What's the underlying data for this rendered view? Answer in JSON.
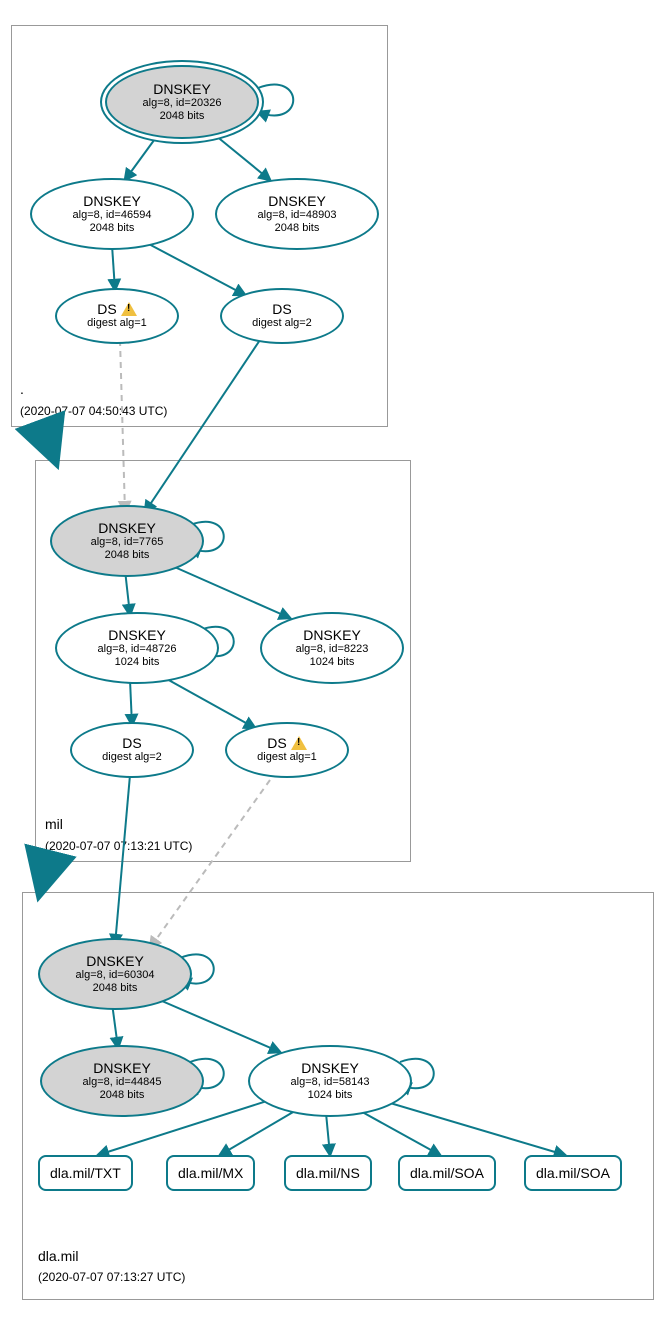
{
  "zones": {
    "root": {
      "name": ".",
      "time": "(2020-07-07 04:50:43 UTC)"
    },
    "mil": {
      "name": "mil",
      "time": "(2020-07-07 07:13:21 UTC)"
    },
    "dla": {
      "name": "dla.mil",
      "time": "(2020-07-07 07:13:27 UTC)"
    }
  },
  "nodes": {
    "root_ksk": {
      "title": "DNSKEY",
      "line1": "alg=8, id=20326",
      "line2": "2048 bits"
    },
    "root_zsk1": {
      "title": "DNSKEY",
      "line1": "alg=8, id=46594",
      "line2": "2048 bits"
    },
    "root_zsk2": {
      "title": "DNSKEY",
      "line1": "alg=8, id=48903",
      "line2": "2048 bits"
    },
    "root_ds1": {
      "title": "DS",
      "line1": "digest alg=1",
      "warn": true
    },
    "root_ds2": {
      "title": "DS",
      "line1": "digest alg=2"
    },
    "mil_ksk": {
      "title": "DNSKEY",
      "line1": "alg=8, id=7765",
      "line2": "2048 bits"
    },
    "mil_zsk1": {
      "title": "DNSKEY",
      "line1": "alg=8, id=48726",
      "line2": "1024 bits"
    },
    "mil_zsk2": {
      "title": "DNSKEY",
      "line1": "alg=8, id=8223",
      "line2": "1024 bits"
    },
    "mil_ds1": {
      "title": "DS",
      "line1": "digest alg=2"
    },
    "mil_ds2": {
      "title": "DS",
      "line1": "digest alg=1",
      "warn": true
    },
    "dla_ksk": {
      "title": "DNSKEY",
      "line1": "alg=8, id=60304",
      "line2": "2048 bits"
    },
    "dla_zsk1": {
      "title": "DNSKEY",
      "line1": "alg=8, id=44845",
      "line2": "2048 bits"
    },
    "dla_zsk2": {
      "title": "DNSKEY",
      "line1": "alg=8, id=58143",
      "line2": "1024 bits"
    }
  },
  "records": {
    "txt": "dla.mil/TXT",
    "mx": "dla.mil/MX",
    "ns": "dla.mil/NS",
    "soa1": "dla.mil/SOA",
    "soa2": "dla.mil/SOA"
  }
}
